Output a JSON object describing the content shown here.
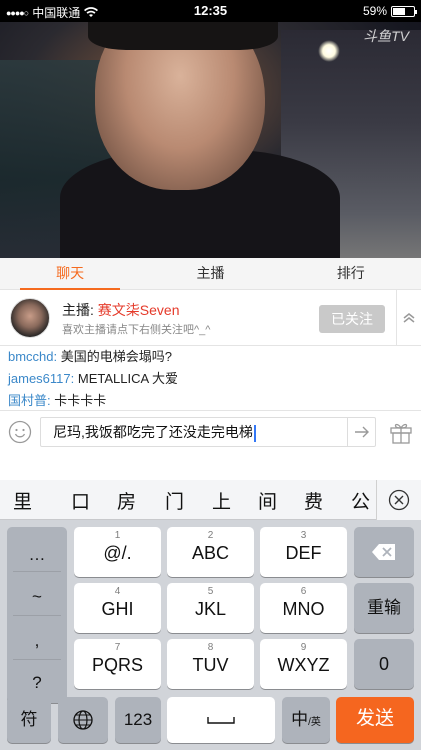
{
  "status_bar": {
    "carrier": "中国联通",
    "time": "12:35",
    "battery": "59%",
    "battery_level": 0.59
  },
  "video": {
    "watermark": "斗鱼TV"
  },
  "tabs": [
    {
      "label": "聊天",
      "active": true
    },
    {
      "label": "主播",
      "active": false
    },
    {
      "label": "排行",
      "active": false
    }
  ],
  "host": {
    "prefix": "主播: ",
    "name": "赛文柒Seven",
    "tip": "喜欢主播请点下右侧关注吧^_^",
    "follow_label": "已关注"
  },
  "chat": [
    {
      "user": "bmcchd:",
      "text": " 美国的电梯会塌吗?"
    },
    {
      "user": "james6117:",
      "text": " METALLICA 大爱"
    },
    {
      "user": "国村普:",
      "text": " 卡卡卡卡"
    }
  ],
  "input": {
    "value": "尼玛,我饭都吃完了还没走完电梯"
  },
  "candidates": [
    "里",
    "口",
    "房",
    "门",
    "上",
    "间",
    "费",
    "公"
  ],
  "keyboard": {
    "symbols": [
      "…",
      "~",
      ",",
      "?"
    ],
    "keys": [
      {
        "num": "1",
        "label": "@/."
      },
      {
        "num": "2",
        "label": "ABC"
      },
      {
        "num": "3",
        "label": "DEF"
      },
      {
        "num": "4",
        "label": "GHI"
      },
      {
        "num": "5",
        "label": "JKL"
      },
      {
        "num": "6",
        "label": "MNO"
      },
      {
        "num": "7",
        "label": "PQRS"
      },
      {
        "num": "8",
        "label": "TUV"
      },
      {
        "num": "9",
        "label": "WXYZ"
      }
    ],
    "reinput": "重输",
    "zero": "0",
    "symbol_key": "符",
    "num_key": "123",
    "lang_main": "中",
    "lang_sub": "/英",
    "send": "发送"
  },
  "colors": {
    "accent": "#f56a1e",
    "host_name": "#e53a2a",
    "chat_user": "#3b88c9",
    "send_key": "#f5661f"
  },
  "icons": [
    "wifi-icon",
    "battery-icon",
    "chevron-up-icon",
    "emoji-icon",
    "send-arrow-icon",
    "gift-icon",
    "close-icon",
    "delete-icon",
    "globe-icon",
    "space-icon"
  ]
}
